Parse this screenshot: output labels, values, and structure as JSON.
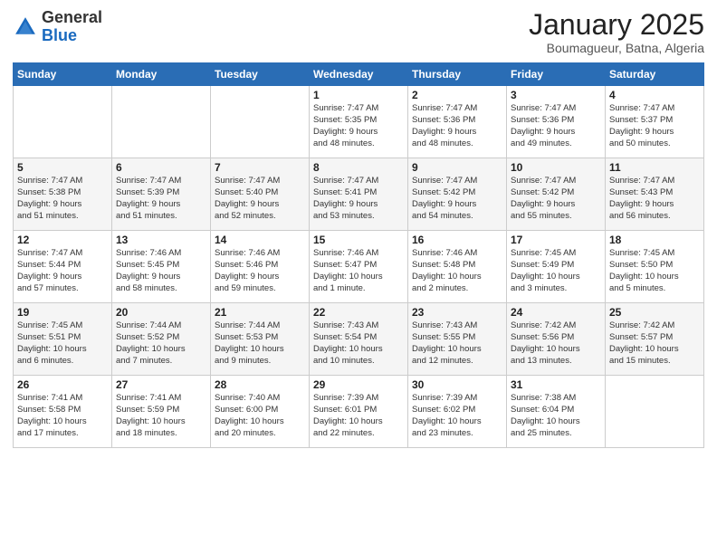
{
  "header": {
    "logo_general": "General",
    "logo_blue": "Blue",
    "month": "January 2025",
    "location": "Boumagueur, Batna, Algeria"
  },
  "days_of_week": [
    "Sunday",
    "Monday",
    "Tuesday",
    "Wednesday",
    "Thursday",
    "Friday",
    "Saturday"
  ],
  "weeks": [
    [
      {
        "day": "",
        "info": ""
      },
      {
        "day": "",
        "info": ""
      },
      {
        "day": "",
        "info": ""
      },
      {
        "day": "1",
        "info": "Sunrise: 7:47 AM\nSunset: 5:35 PM\nDaylight: 9 hours\nand 48 minutes."
      },
      {
        "day": "2",
        "info": "Sunrise: 7:47 AM\nSunset: 5:36 PM\nDaylight: 9 hours\nand 48 minutes."
      },
      {
        "day": "3",
        "info": "Sunrise: 7:47 AM\nSunset: 5:36 PM\nDaylight: 9 hours\nand 49 minutes."
      },
      {
        "day": "4",
        "info": "Sunrise: 7:47 AM\nSunset: 5:37 PM\nDaylight: 9 hours\nand 50 minutes."
      }
    ],
    [
      {
        "day": "5",
        "info": "Sunrise: 7:47 AM\nSunset: 5:38 PM\nDaylight: 9 hours\nand 51 minutes."
      },
      {
        "day": "6",
        "info": "Sunrise: 7:47 AM\nSunset: 5:39 PM\nDaylight: 9 hours\nand 51 minutes."
      },
      {
        "day": "7",
        "info": "Sunrise: 7:47 AM\nSunset: 5:40 PM\nDaylight: 9 hours\nand 52 minutes."
      },
      {
        "day": "8",
        "info": "Sunrise: 7:47 AM\nSunset: 5:41 PM\nDaylight: 9 hours\nand 53 minutes."
      },
      {
        "day": "9",
        "info": "Sunrise: 7:47 AM\nSunset: 5:42 PM\nDaylight: 9 hours\nand 54 minutes."
      },
      {
        "day": "10",
        "info": "Sunrise: 7:47 AM\nSunset: 5:42 PM\nDaylight: 9 hours\nand 55 minutes."
      },
      {
        "day": "11",
        "info": "Sunrise: 7:47 AM\nSunset: 5:43 PM\nDaylight: 9 hours\nand 56 minutes."
      }
    ],
    [
      {
        "day": "12",
        "info": "Sunrise: 7:47 AM\nSunset: 5:44 PM\nDaylight: 9 hours\nand 57 minutes."
      },
      {
        "day": "13",
        "info": "Sunrise: 7:46 AM\nSunset: 5:45 PM\nDaylight: 9 hours\nand 58 minutes."
      },
      {
        "day": "14",
        "info": "Sunrise: 7:46 AM\nSunset: 5:46 PM\nDaylight: 9 hours\nand 59 minutes."
      },
      {
        "day": "15",
        "info": "Sunrise: 7:46 AM\nSunset: 5:47 PM\nDaylight: 10 hours\nand 1 minute."
      },
      {
        "day": "16",
        "info": "Sunrise: 7:46 AM\nSunset: 5:48 PM\nDaylight: 10 hours\nand 2 minutes."
      },
      {
        "day": "17",
        "info": "Sunrise: 7:45 AM\nSunset: 5:49 PM\nDaylight: 10 hours\nand 3 minutes."
      },
      {
        "day": "18",
        "info": "Sunrise: 7:45 AM\nSunset: 5:50 PM\nDaylight: 10 hours\nand 5 minutes."
      }
    ],
    [
      {
        "day": "19",
        "info": "Sunrise: 7:45 AM\nSunset: 5:51 PM\nDaylight: 10 hours\nand 6 minutes."
      },
      {
        "day": "20",
        "info": "Sunrise: 7:44 AM\nSunset: 5:52 PM\nDaylight: 10 hours\nand 7 minutes."
      },
      {
        "day": "21",
        "info": "Sunrise: 7:44 AM\nSunset: 5:53 PM\nDaylight: 10 hours\nand 9 minutes."
      },
      {
        "day": "22",
        "info": "Sunrise: 7:43 AM\nSunset: 5:54 PM\nDaylight: 10 hours\nand 10 minutes."
      },
      {
        "day": "23",
        "info": "Sunrise: 7:43 AM\nSunset: 5:55 PM\nDaylight: 10 hours\nand 12 minutes."
      },
      {
        "day": "24",
        "info": "Sunrise: 7:42 AM\nSunset: 5:56 PM\nDaylight: 10 hours\nand 13 minutes."
      },
      {
        "day": "25",
        "info": "Sunrise: 7:42 AM\nSunset: 5:57 PM\nDaylight: 10 hours\nand 15 minutes."
      }
    ],
    [
      {
        "day": "26",
        "info": "Sunrise: 7:41 AM\nSunset: 5:58 PM\nDaylight: 10 hours\nand 17 minutes."
      },
      {
        "day": "27",
        "info": "Sunrise: 7:41 AM\nSunset: 5:59 PM\nDaylight: 10 hours\nand 18 minutes."
      },
      {
        "day": "28",
        "info": "Sunrise: 7:40 AM\nSunset: 6:00 PM\nDaylight: 10 hours\nand 20 minutes."
      },
      {
        "day": "29",
        "info": "Sunrise: 7:39 AM\nSunset: 6:01 PM\nDaylight: 10 hours\nand 22 minutes."
      },
      {
        "day": "30",
        "info": "Sunrise: 7:39 AM\nSunset: 6:02 PM\nDaylight: 10 hours\nand 23 minutes."
      },
      {
        "day": "31",
        "info": "Sunrise: 7:38 AM\nSunset: 6:04 PM\nDaylight: 10 hours\nand 25 minutes."
      },
      {
        "day": "",
        "info": ""
      }
    ]
  ]
}
